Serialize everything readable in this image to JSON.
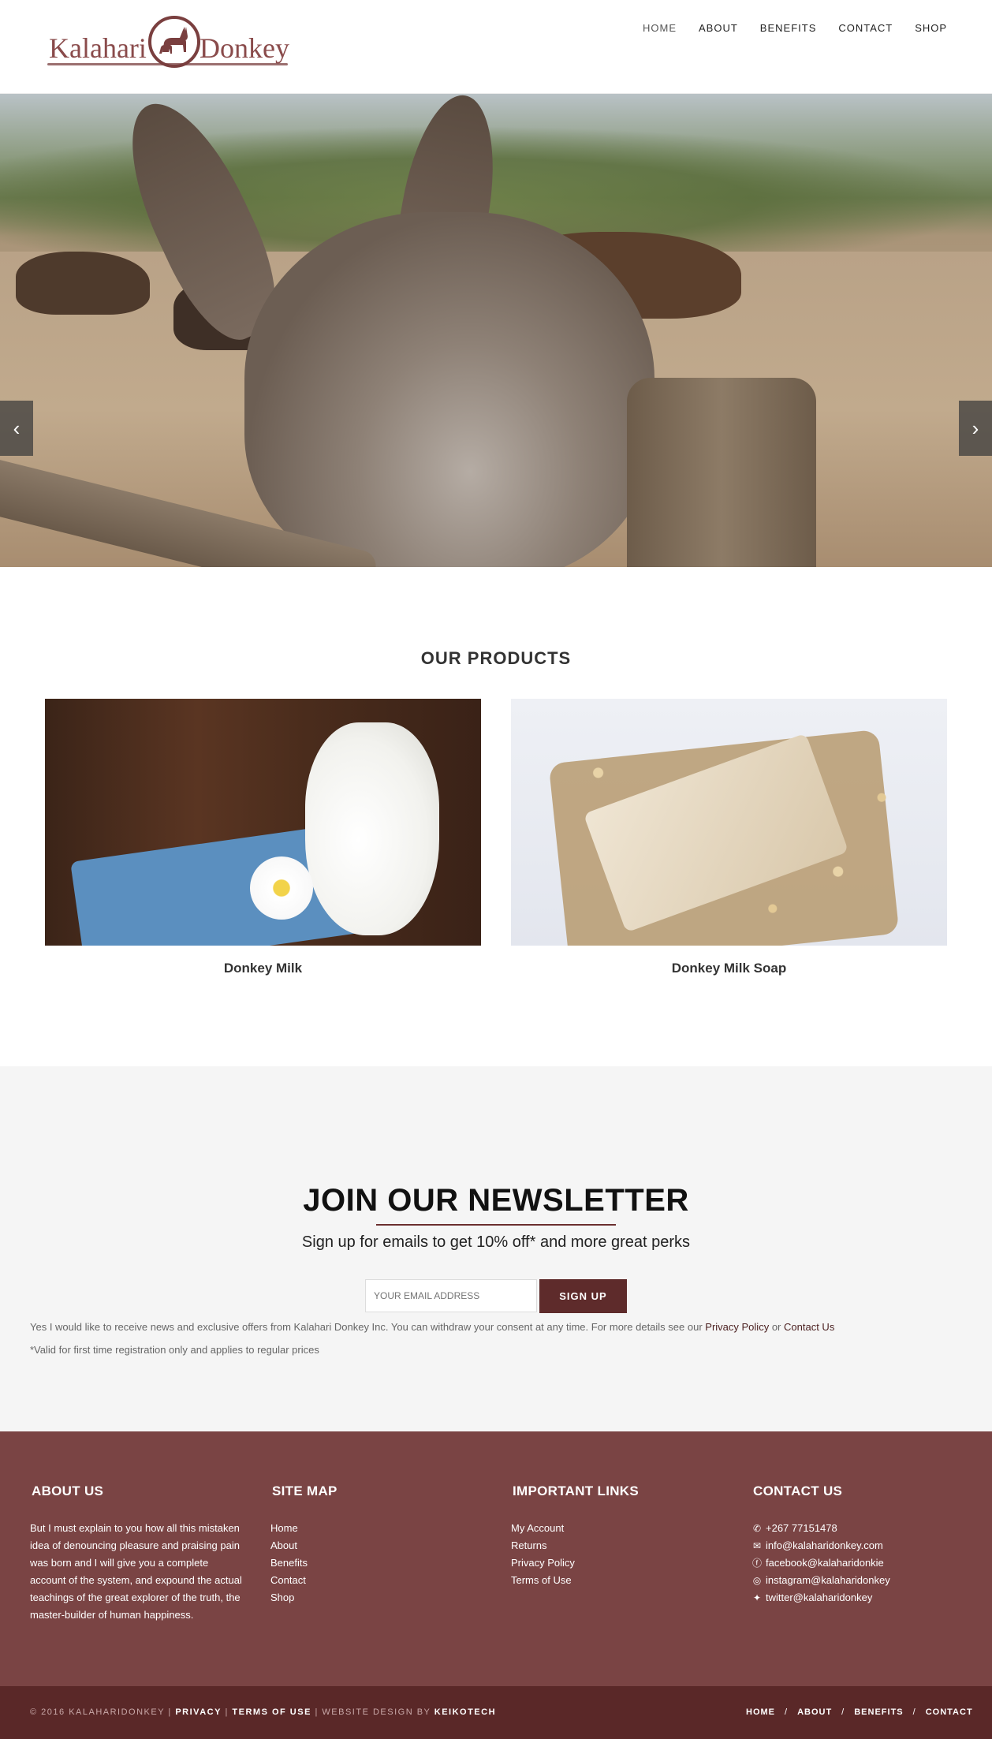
{
  "brand": {
    "name_left": "Kalahari",
    "name_right": "Donkey",
    "logo_color": "#7a3f3f"
  },
  "nav": {
    "items": [
      "HOME",
      "ABOUT",
      "BENEFITS",
      "CONTACT",
      "SHOP"
    ],
    "active": "HOME"
  },
  "hero": {
    "prev_icon": "chevron-left-icon",
    "next_icon": "chevron-right-icon",
    "prev_glyph": "‹",
    "next_glyph": "›"
  },
  "products": {
    "title": "OUR PRODUCTS",
    "items": [
      {
        "name": "Donkey Milk"
      },
      {
        "name": "Donkey Milk Soap"
      }
    ]
  },
  "newsletter": {
    "title": "JOIN OUR NEWSLETTER",
    "subtitle": "Sign up for emails to get 10% off* and more great perks",
    "email_placeholder": "YOUR EMAIL ADDRESS",
    "button_label": "SIGN UP",
    "consent_text": "Yes I would like to receive news and exclusive offers from Kalahari Donkey Inc. You can withdraw your consent at any time. For more details see our",
    "privacy_link": "Privacy Policy",
    "or_text": "or",
    "contact_link": "Contact Us",
    "note": "*Valid for first time registration only and applies to regular prices",
    "button_color": "#5e2b2b"
  },
  "footer": {
    "about": {
      "title": "ABOUT US",
      "text": "But I must explain to you how all this mistaken idea of denouncing pleasure and praising pain was born and I will give you a complete account of the system, and expound the actual teachings of the great explorer of the truth, the master-builder of human happiness."
    },
    "sitemap": {
      "title": "SITE MAP",
      "links": [
        "Home",
        "About",
        "Benefits",
        "Contact",
        "Shop"
      ]
    },
    "important": {
      "title": "IMPORTANT LINKS",
      "links": [
        "My Account",
        "Returns",
        "Privacy Policy",
        "Terms of Use"
      ]
    },
    "contact": {
      "title": "CONTACT US",
      "phone": "+267 77151478",
      "email": "info@kalaharidonkey.com",
      "facebook": "facebook@kalaharidonkie",
      "instagram": "instagram@kalaharidonkey",
      "twitter": "twitter@kalaharidonkey"
    },
    "background": "#7a4444"
  },
  "bottom_bar": {
    "copyright": "© 2016 KALAHARIDONKEY |",
    "privacy": "PRIVACY",
    "sep": "|",
    "terms": "TERMS OF USE",
    "design_by": "| WEBSITE DESIGN BY",
    "designer": "KEIKOTECH",
    "nav": [
      "HOME",
      "ABOUT",
      "BENEFITS",
      "CONTACT"
    ],
    "nav_sep": "/",
    "background": "#5a2828"
  }
}
